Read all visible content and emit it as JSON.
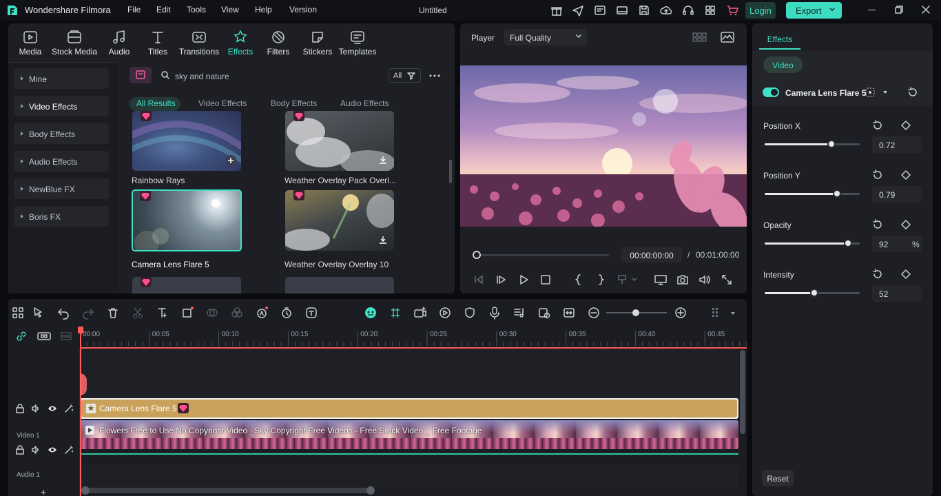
{
  "app": {
    "name": "Wondershare Filmora",
    "project_title": "Untitled"
  },
  "menu": [
    "File",
    "Edit",
    "Tools",
    "View",
    "Help",
    "Version"
  ],
  "header_buttons": {
    "login": "Login",
    "export": "Export"
  },
  "media_tabs": [
    "Media",
    "Stock Media",
    "Audio",
    "Titles",
    "Transitions",
    "Effects",
    "Filters",
    "Stickers",
    "Templates"
  ],
  "categories": [
    "Mine",
    "Video Effects",
    "Body Effects",
    "Audio Effects",
    "NewBlue FX",
    "Boris FX"
  ],
  "search": {
    "value": "sky and nature",
    "filter_label": "All"
  },
  "result_tabs": [
    "All Results",
    "Video Effects",
    "Body Effects",
    "Audio Effects"
  ],
  "effects": [
    {
      "name": "Rainbow Rays"
    },
    {
      "name": "Weather Overlay Pack Overl..."
    },
    {
      "name": "Camera Lens Flare 5"
    },
    {
      "name": "Weather Overlay Overlay 10"
    }
  ],
  "player": {
    "label": "Player",
    "quality": "Full Quality",
    "current_time": "00:00:00:00",
    "separator": "/",
    "total_time": "00:01:00:00"
  },
  "right_panel": {
    "tab": "Effects",
    "subtab": "Video",
    "effect_name": "Camera Lens Flare 5",
    "properties": [
      {
        "label": "Position X",
        "value": "0.72",
        "level": 0.7,
        "unit": ""
      },
      {
        "label": "Position Y",
        "value": "0.79",
        "level": 0.76,
        "unit": ""
      },
      {
        "label": "Opacity",
        "value": "92",
        "level": 0.88,
        "unit": "%"
      },
      {
        "label": "Intensity",
        "value": "52",
        "level": 0.52,
        "unit": ""
      }
    ],
    "reset": "Reset"
  },
  "timeline": {
    "ruler": [
      "00:00",
      "00:05",
      "00:10",
      "00:15",
      "00:20",
      "00:25",
      "00:30",
      "00:35",
      "00:40",
      "00:45"
    ],
    "tracks": {
      "video": "Video 1",
      "audio": "Audio 1"
    },
    "effect_clip": "Camera Lens Flare 5",
    "video_clip": "Flowers Free to Use No Copyright Video _Sky Copyright Free Videos - Free Stock Video _ Free Footage"
  },
  "colors": {
    "accent": "#3fe0c5",
    "export_bg": "#3ddcc1",
    "effect_clip": "#c9a15a",
    "playhead": "#ff5a5a",
    "gem": "#ff4d8d"
  }
}
